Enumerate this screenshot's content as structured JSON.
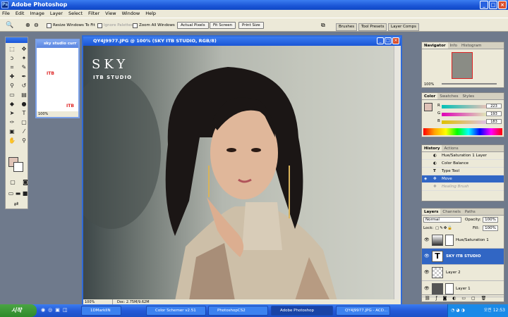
{
  "app": {
    "title": "Adobe Photoshop"
  },
  "menu": [
    "File",
    "Edit",
    "Image",
    "Layer",
    "Select",
    "Filter",
    "View",
    "Window",
    "Help"
  ],
  "options": {
    "resize_windows": "Resize Windows To Fit",
    "ignore_palettes": "Ignore Palettes",
    "zoom_all": "Zoom All Windows",
    "actual_pixels": "Actual Pixels",
    "fit_screen": "Fit Screen",
    "print_size": "Print Size"
  },
  "well_tabs": [
    "Brushes",
    "Tool Presets",
    "Layer Comps"
  ],
  "small_doc": {
    "title": "sky studio curr",
    "text1": "ITB",
    "text2": "ITB",
    "zoom": "100%"
  },
  "doc": {
    "title": "QY4J9977.JPG @ 100% (SKY ITB STUDIO, RGB/8)",
    "watermark_sky": "SKY",
    "watermark_studio": "ITB STUDIO",
    "zoom": "100%",
    "doc_info": "Doc: 2.75M/9.62M"
  },
  "navigator": {
    "tabs": [
      "Navigator",
      "Info",
      "Histogram"
    ],
    "zoom": "100%"
  },
  "color": {
    "tabs": [
      "Color",
      "Swatches",
      "Styles"
    ],
    "channels": [
      {
        "label": "R",
        "value": "223"
      },
      {
        "label": "G",
        "value": "193"
      },
      {
        "label": "B",
        "value": "183"
      }
    ],
    "foreground_hex": "#dfc1b7"
  },
  "history": {
    "tabs": [
      "History",
      "Actions"
    ],
    "items": [
      {
        "label": "Hue/Saturation 1 Layer",
        "state": "normal"
      },
      {
        "label": "Color Balance",
        "state": "normal"
      },
      {
        "label": "Type Tool",
        "state": "normal"
      },
      {
        "label": "Move",
        "state": "selected"
      },
      {
        "label": "Healing Brush",
        "state": "dim"
      }
    ]
  },
  "layers": {
    "tabs": [
      "Layers",
      "Channels",
      "Paths"
    ],
    "blend_mode": "Normal",
    "opacity_label": "Opacity:",
    "opacity": "100%",
    "lock_label": "Lock:",
    "fill_label": "Fill:",
    "fill": "100%",
    "items": [
      {
        "name": "Hue/Saturation 1",
        "selected": false
      },
      {
        "name": "SKY ITB STUDIO",
        "selected": true
      },
      {
        "name": "Layer 2",
        "selected": false
      },
      {
        "name": "Layer 1",
        "selected": false
      }
    ]
  },
  "taskbar": {
    "start": "시작",
    "buttons": [
      {
        "label": "1DMarkIIN",
        "active": false
      },
      {
        "label": "Color Schemer v2.51",
        "active": false
      },
      {
        "label": "PhotoshopCS2",
        "active": false
      },
      {
        "label": "Adobe Photoshop",
        "active": true
      },
      {
        "label": "QY4J9977.JPG - ACD...",
        "active": false
      }
    ],
    "clock": "오전 12:53"
  }
}
